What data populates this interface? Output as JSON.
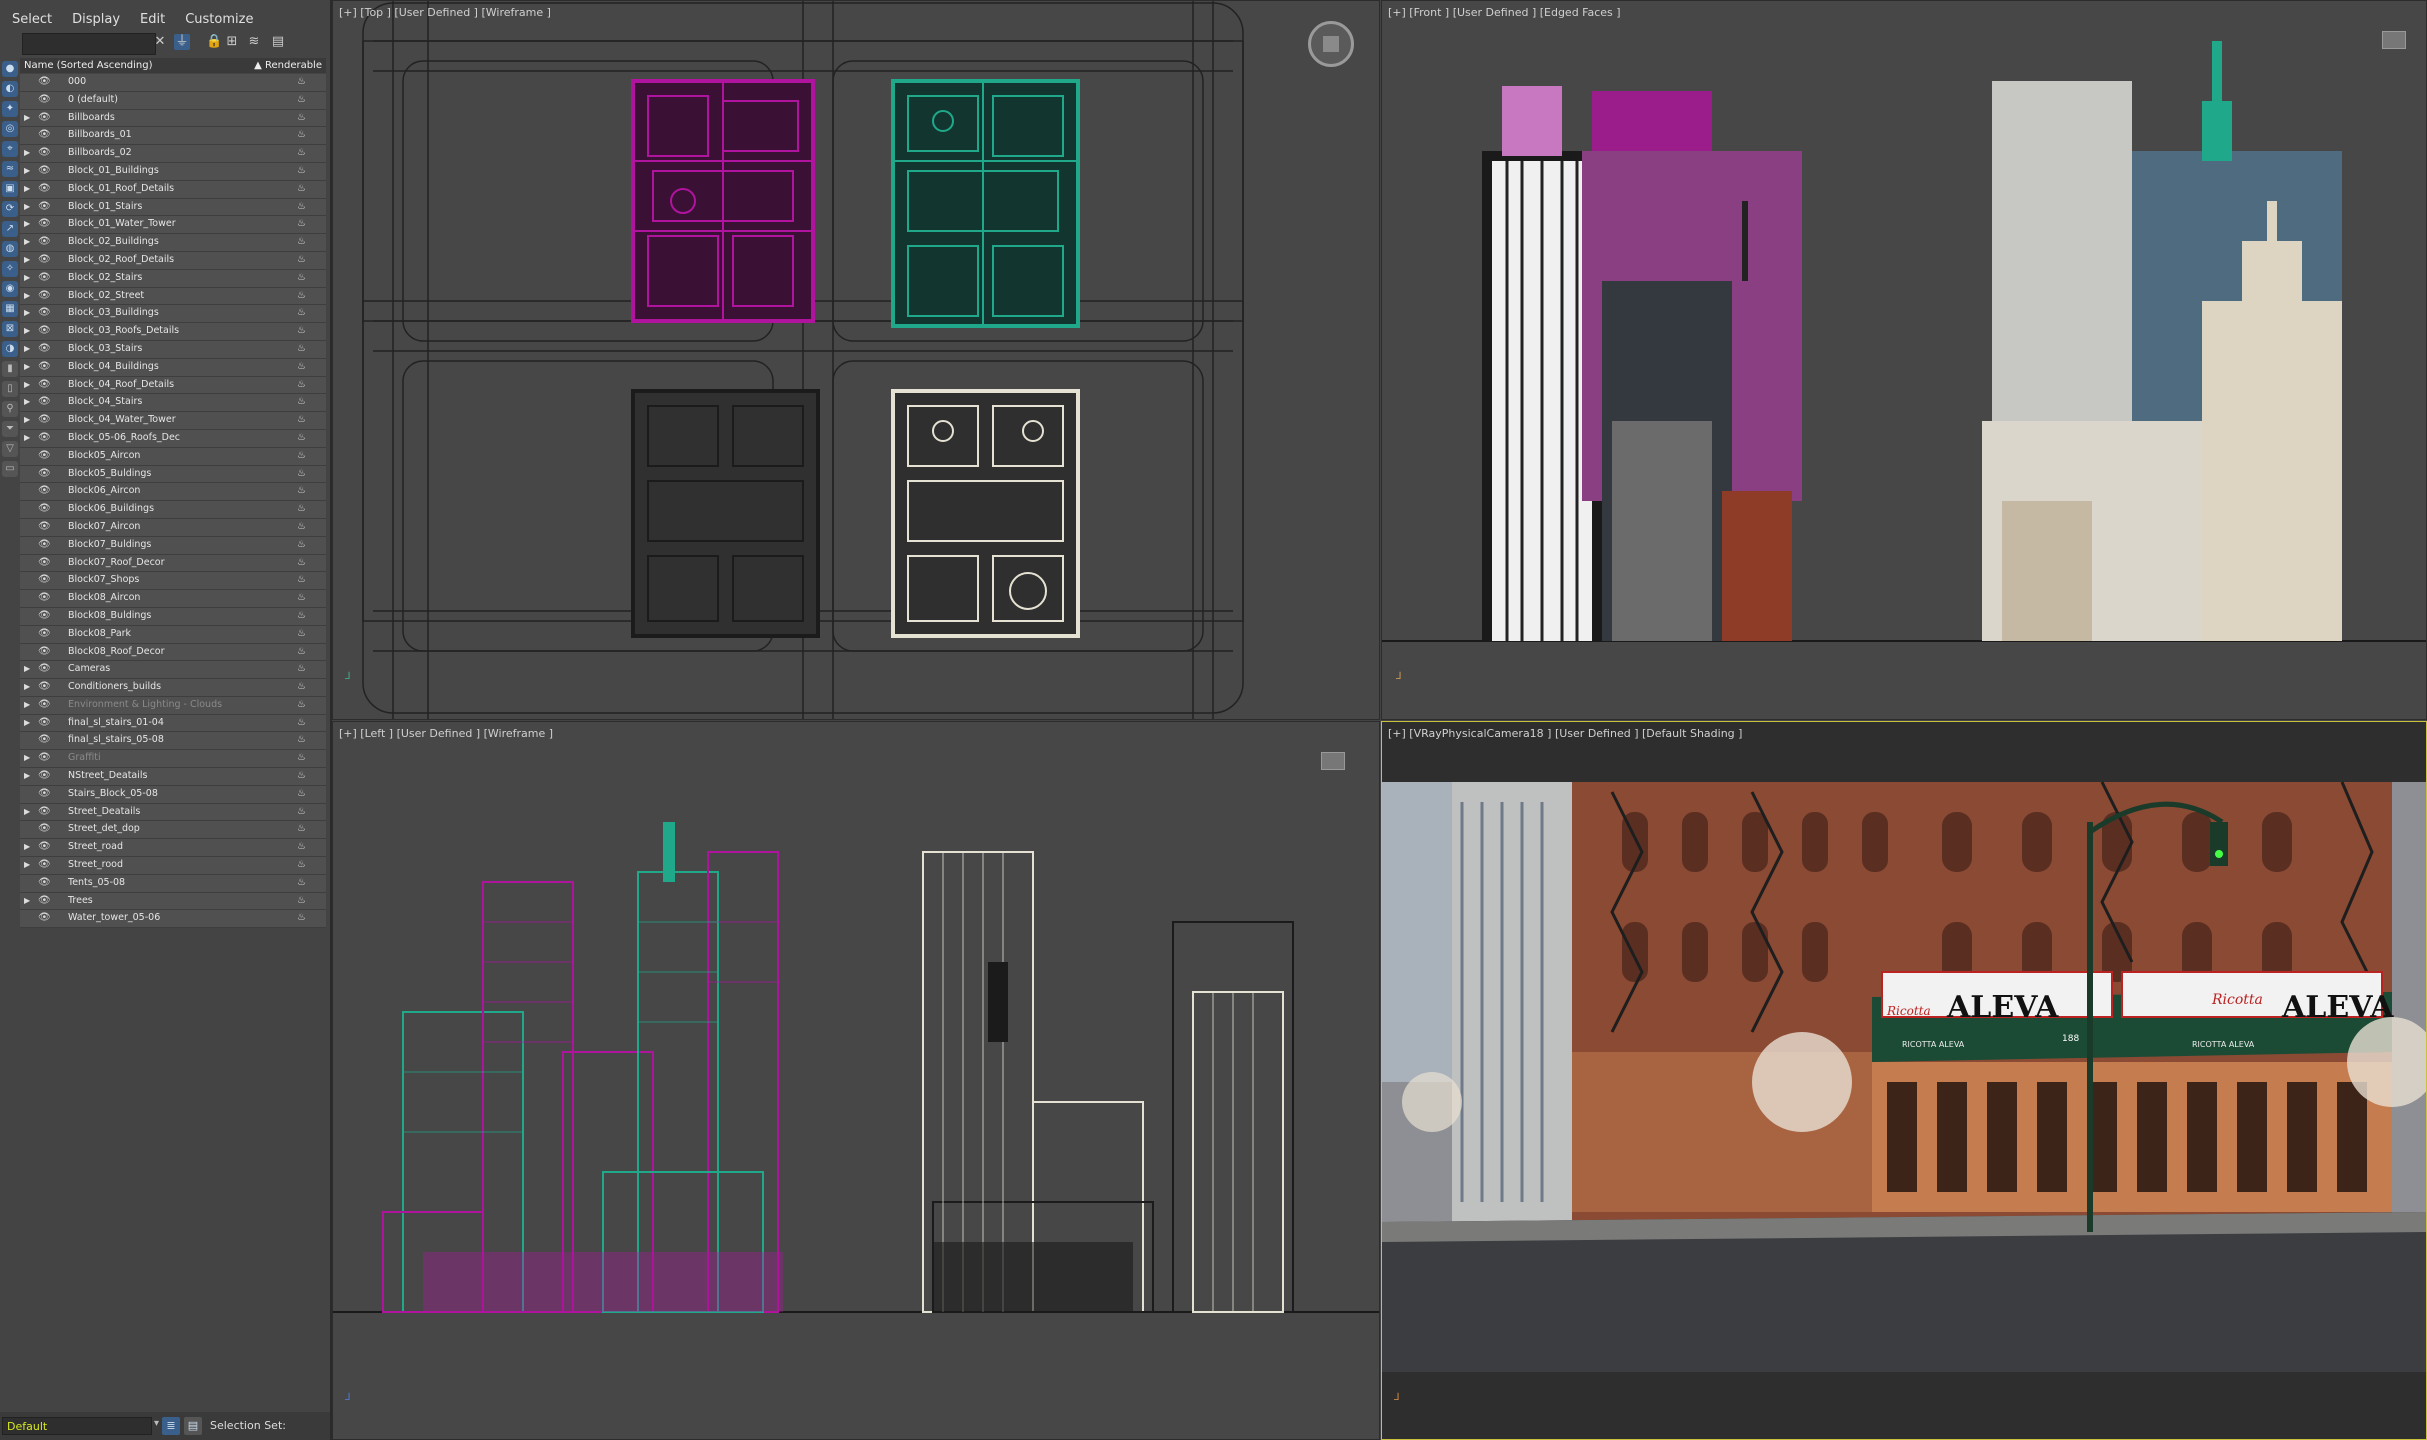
{
  "menu": [
    "Select",
    "Display",
    "Edit",
    "Customize"
  ],
  "explorer": {
    "column_name": "Name (Sorted Ascending)",
    "column_renderable": "▲ Renderable",
    "layers": [
      {
        "name": "000",
        "expand": false,
        "dim": false
      },
      {
        "name": "0 (default)",
        "expand": false,
        "dim": false
      },
      {
        "name": "Billboards",
        "expand": true,
        "dim": false
      },
      {
        "name": "Billboards_01",
        "expand": false,
        "dim": false
      },
      {
        "name": "Billboards_02",
        "expand": true,
        "dim": false
      },
      {
        "name": "Block_01_Buildings",
        "expand": true,
        "dim": false
      },
      {
        "name": "Block_01_Roof_Details",
        "expand": true,
        "dim": false
      },
      {
        "name": "Block_01_Stairs",
        "expand": true,
        "dim": false
      },
      {
        "name": "Block_01_Water_Tower",
        "expand": true,
        "dim": false
      },
      {
        "name": "Block_02_Buildings",
        "expand": true,
        "dim": false
      },
      {
        "name": "Block_02_Roof_Details",
        "expand": true,
        "dim": false
      },
      {
        "name": "Block_02_Stairs",
        "expand": true,
        "dim": false
      },
      {
        "name": "Block_02_Street",
        "expand": true,
        "dim": false
      },
      {
        "name": "Block_03_Buildings",
        "expand": true,
        "dim": false
      },
      {
        "name": "Block_03_Roofs_Details",
        "expand": true,
        "dim": false
      },
      {
        "name": "Block_03_Stairs",
        "expand": true,
        "dim": false
      },
      {
        "name": "Block_04_Buildings",
        "expand": true,
        "dim": false
      },
      {
        "name": "Block_04_Roof_Details",
        "expand": true,
        "dim": false
      },
      {
        "name": "Block_04_Stairs",
        "expand": true,
        "dim": false
      },
      {
        "name": "Block_04_Water_Tower",
        "expand": true,
        "dim": false
      },
      {
        "name": "Block_05-06_Roofs_Dec",
        "expand": true,
        "dim": false
      },
      {
        "name": "Block05_Aircon",
        "expand": false,
        "dim": false
      },
      {
        "name": "Block05_Buldings",
        "expand": false,
        "dim": false
      },
      {
        "name": "Block06_Aircon",
        "expand": false,
        "dim": false
      },
      {
        "name": "Block06_Buildings",
        "expand": false,
        "dim": false
      },
      {
        "name": "Block07_Aircon",
        "expand": false,
        "dim": false
      },
      {
        "name": "Block07_Buldings",
        "expand": false,
        "dim": false
      },
      {
        "name": "Block07_Roof_Decor",
        "expand": false,
        "dim": false
      },
      {
        "name": "Block07_Shops",
        "expand": false,
        "dim": false
      },
      {
        "name": "Block08_Aircon",
        "expand": false,
        "dim": false
      },
      {
        "name": "Block08_Buldings",
        "expand": false,
        "dim": false
      },
      {
        "name": "Block08_Park",
        "expand": false,
        "dim": false
      },
      {
        "name": "Block08_Roof_Decor",
        "expand": false,
        "dim": false
      },
      {
        "name": "Cameras",
        "expand": true,
        "dim": false
      },
      {
        "name": "Conditioners_builds",
        "expand": true,
        "dim": false
      },
      {
        "name": "Environment & Lighting - Clouds",
        "expand": true,
        "dim": true
      },
      {
        "name": "final_sl_stairs_01-04",
        "expand": true,
        "dim": false
      },
      {
        "name": "final_sl_stairs_05-08",
        "expand": false,
        "dim": false
      },
      {
        "name": "Graffiti",
        "expand": true,
        "dim": true
      },
      {
        "name": "NStreet_Deatails",
        "expand": true,
        "dim": false
      },
      {
        "name": "Stairs_Block_05-08",
        "expand": false,
        "dim": false
      },
      {
        "name": "Street_Deatails",
        "expand": true,
        "dim": false
      },
      {
        "name": "Street_det_dop",
        "expand": false,
        "dim": false
      },
      {
        "name": "Street_road",
        "expand": true,
        "dim": false
      },
      {
        "name": "Street_rood",
        "expand": true,
        "dim": false
      },
      {
        "name": "Tents_05-08",
        "expand": false,
        "dim": false
      },
      {
        "name": "Trees",
        "expand": true,
        "dim": false
      },
      {
        "name": "Water_tower_05-06",
        "expand": false,
        "dim": false
      }
    ],
    "layer_dropdown": "Default",
    "selection_set_label": "Selection Set:"
  },
  "viewports": {
    "top": "[+] [Top ] [User Defined ] [Wireframe ]",
    "front": "[+] [Front ] [User Defined ] [Edged Faces ]",
    "left": "[+] [Left ] [User Defined ] [Wireframe ]",
    "camera": "[+] [VRayPhysicalCamera18 ] [User Defined ] [Default Shading ]"
  },
  "scene_signs": {
    "shop_name": "ALEVA",
    "script_sign": "Ricotta",
    "awning_text": "RICOTTA ALEVA",
    "address": "188"
  },
  "colors": {
    "magenta": "#b0139e",
    "teal": "#1fa88a",
    "selection_yellow": "#c9c23a",
    "layer_yellow": "#d8e820"
  }
}
